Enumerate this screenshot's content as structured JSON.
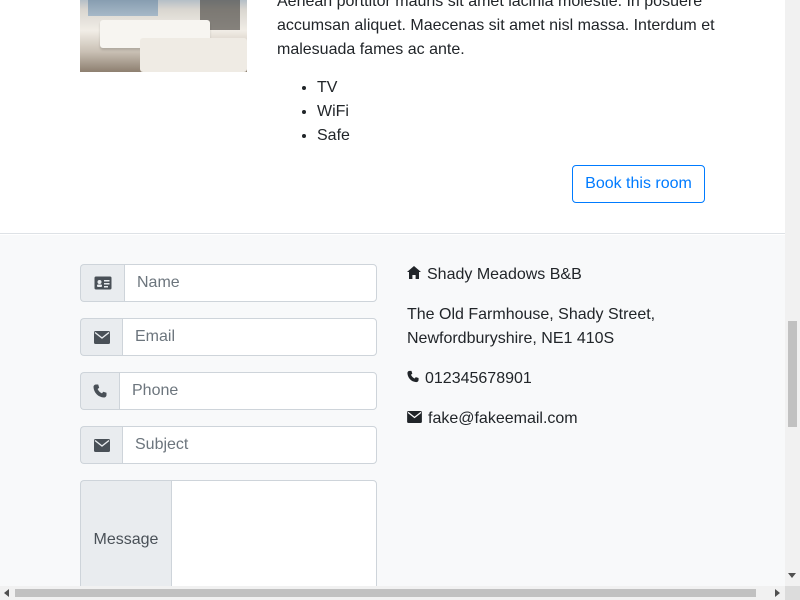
{
  "room": {
    "description": "Aenean porttitor mauris sit amet lacinia molestie. In posuere accumsan aliquet. Maecenas sit amet nisl massa. Interdum et malesuada fames ac ante.",
    "amenities": [
      "TV",
      "WiFi",
      "Safe"
    ],
    "book_label": "Book this room"
  },
  "contact_form": {
    "name_placeholder": "Name",
    "email_placeholder": "Email",
    "phone_placeholder": "Phone",
    "subject_placeholder": "Subject",
    "message_label": "Message"
  },
  "contact_info": {
    "business_name": "Shady Meadows B&B",
    "address_line1": "The Old Farmhouse, Shady Street,",
    "address_line2": "Newfordburyshire, NE1 410S",
    "phone": "012345678901",
    "email": "fake@fakeemail.com"
  },
  "icons": {
    "name": "id-card-icon",
    "email": "envelope-icon",
    "phone": "phone-icon",
    "subject": "envelope-icon",
    "business": "home-icon"
  },
  "colors": {
    "accent": "#007bff",
    "section_bg": "#f8f9fa",
    "addon_bg": "#e9ecef",
    "border": "#ced4da"
  }
}
